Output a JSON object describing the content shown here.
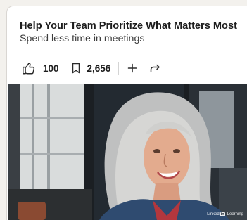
{
  "post": {
    "title": "Help Your Team Prioritize What Matters Most",
    "subtitle": "Spend less time in meetings"
  },
  "actions": {
    "like_count": "100",
    "save_count": "2,656"
  },
  "icons": {
    "like": "thumbs-up-icon",
    "save": "bookmark-icon",
    "add": "plus-icon",
    "share": "share-arrow-icon"
  },
  "video": {
    "watermark_prefix": "Linked",
    "watermark_in": "in",
    "watermark_suffix": "Learning"
  }
}
